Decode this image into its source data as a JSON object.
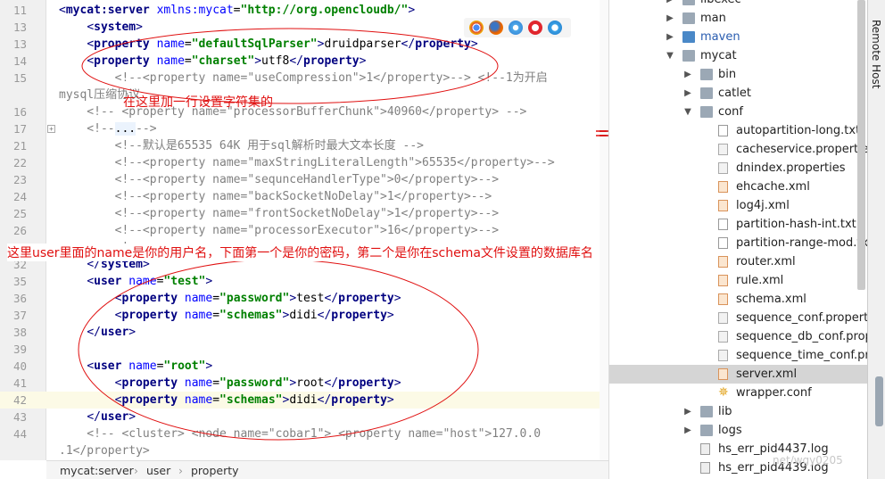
{
  "editor": {
    "lines": [
      {
        "num": "11",
        "parts": [
          [
            "br",
            "<"
          ],
          [
            "tg",
            "mycat:server"
          ],
          [
            "tx",
            " "
          ],
          [
            "at",
            "xmlns:mycat"
          ],
          [
            "tx",
            "="
          ],
          [
            "av",
            "\"http://org.opencloudb/\""
          ],
          [
            "br",
            ">"
          ]
        ]
      },
      {
        "num": "13",
        "parts": [
          [
            "tx",
            "    "
          ],
          [
            "br",
            "<"
          ],
          [
            "tg",
            "system"
          ],
          [
            "br",
            ">"
          ]
        ]
      },
      {
        "num": "13",
        "parts": [
          [
            "tx",
            "    "
          ],
          [
            "br",
            "<"
          ],
          [
            "tg",
            "property"
          ],
          [
            "tx",
            " "
          ],
          [
            "at",
            "name"
          ],
          [
            "tx",
            "="
          ],
          [
            "av",
            "\"defaultSqlParser\""
          ],
          [
            "br",
            ">"
          ],
          [
            "tx",
            "druidparser"
          ],
          [
            "br",
            "</"
          ],
          [
            "tg",
            "property"
          ],
          [
            "br",
            ">"
          ]
        ]
      },
      {
        "num": "14",
        "parts": [
          [
            "tx",
            "    "
          ],
          [
            "br",
            "<"
          ],
          [
            "tg",
            "property"
          ],
          [
            "tx",
            " "
          ],
          [
            "at",
            "name"
          ],
          [
            "tx",
            "="
          ],
          [
            "av",
            "\"charset\""
          ],
          [
            "br",
            ">"
          ],
          [
            "tx",
            "utf8"
          ],
          [
            "br",
            "</"
          ],
          [
            "tg",
            "property"
          ],
          [
            "br",
            ">"
          ]
        ]
      },
      {
        "num": "15",
        "parts": [
          [
            "cm",
            "        <!--<property name=\"useCompression\">1</property>--> <!--1为开启"
          ]
        ]
      },
      {
        "num": "",
        "parts": [
          [
            "cm",
            "mysql压缩协议"
          ]
        ]
      },
      {
        "num": "16",
        "parts": [
          [
            "cm",
            "    <!-- <property name=\"processorBufferChunk\">40960</property> -->"
          ]
        ]
      },
      {
        "num": "17",
        "parts": [
          [
            "cm",
            "    <!--"
          ],
          [
            "hlbox",
            "..."
          ],
          [
            "cm",
            "-->"
          ]
        ]
      },
      {
        "num": "21",
        "parts": [
          [
            "cm",
            "        <!--默认是65535 64K 用于sql解析时最大文本长度 -->"
          ]
        ]
      },
      {
        "num": "22",
        "parts": [
          [
            "cm",
            "        <!--<property name=\"maxStringLiteralLength\">65535</property>-->"
          ]
        ]
      },
      {
        "num": "23",
        "parts": [
          [
            "cm",
            "        <!--<property name=\"sequnceHandlerType\">0</property>-->"
          ]
        ]
      },
      {
        "num": "24",
        "parts": [
          [
            "cm",
            "        <!--<property name=\"backSocketNoDelay\">1</property>-->"
          ]
        ]
      },
      {
        "num": "25",
        "parts": [
          [
            "cm",
            "        <!--<property name=\"frontSocketNoDelay\">1</property>-->"
          ]
        ]
      },
      {
        "num": "26",
        "parts": [
          [
            "cm",
            "        <!--<property name=\"processorExecutor\">16</property>-->"
          ]
        ]
      },
      {
        "num": "27",
        "parts": [
          [
            "cm",
            "        <!--"
          ]
        ]
      },
      {
        "num": "32",
        "parts": [
          [
            "tx",
            "    "
          ],
          [
            "br",
            "</"
          ],
          [
            "tg",
            "system"
          ],
          [
            "br",
            ">"
          ]
        ]
      },
      {
        "num": "35",
        "parts": [
          [
            "tx",
            "    "
          ],
          [
            "br",
            "<"
          ],
          [
            "tg",
            "user"
          ],
          [
            "tx",
            " "
          ],
          [
            "at",
            "name"
          ],
          [
            "tx",
            "="
          ],
          [
            "av",
            "\"test\""
          ],
          [
            "br",
            ">"
          ]
        ]
      },
      {
        "num": "36",
        "parts": [
          [
            "tx",
            "        "
          ],
          [
            "br",
            "<"
          ],
          [
            "tg",
            "property"
          ],
          [
            "tx",
            " "
          ],
          [
            "at",
            "name"
          ],
          [
            "tx",
            "="
          ],
          [
            "av",
            "\"password\""
          ],
          [
            "br",
            ">"
          ],
          [
            "tx",
            "test"
          ],
          [
            "br",
            "</"
          ],
          [
            "tg",
            "property"
          ],
          [
            "br",
            ">"
          ]
        ]
      },
      {
        "num": "37",
        "parts": [
          [
            "tx",
            "        "
          ],
          [
            "br",
            "<"
          ],
          [
            "tg",
            "property"
          ],
          [
            "tx",
            " "
          ],
          [
            "at",
            "name"
          ],
          [
            "tx",
            "="
          ],
          [
            "av",
            "\"schemas\""
          ],
          [
            "br",
            ">"
          ],
          [
            "tx",
            "didi"
          ],
          [
            "br",
            "</"
          ],
          [
            "tg",
            "property"
          ],
          [
            "br",
            ">"
          ]
        ]
      },
      {
        "num": "38",
        "parts": [
          [
            "tx",
            "    "
          ],
          [
            "br",
            "</"
          ],
          [
            "tg",
            "user"
          ],
          [
            "br",
            ">"
          ]
        ]
      },
      {
        "num": "39",
        "parts": [
          [
            "tx",
            ""
          ]
        ]
      },
      {
        "num": "40",
        "parts": [
          [
            "tx",
            "    "
          ],
          [
            "br",
            "<"
          ],
          [
            "tg",
            "user"
          ],
          [
            "tx",
            " "
          ],
          [
            "at",
            "name"
          ],
          [
            "tx",
            "="
          ],
          [
            "av",
            "\"root\""
          ],
          [
            "br",
            ">"
          ]
        ]
      },
      {
        "num": "41",
        "parts": [
          [
            "tx",
            "        "
          ],
          [
            "br",
            "<"
          ],
          [
            "tg",
            "property"
          ],
          [
            "tx",
            " "
          ],
          [
            "at",
            "name"
          ],
          [
            "tx",
            "="
          ],
          [
            "av",
            "\"password\""
          ],
          [
            "br",
            ">"
          ],
          [
            "tx",
            "root"
          ],
          [
            "br",
            "</"
          ],
          [
            "tg",
            "property"
          ],
          [
            "br",
            ">"
          ]
        ]
      },
      {
        "num": "42",
        "parts": [
          [
            "tx",
            "        "
          ],
          [
            "br",
            "<"
          ],
          [
            "tg",
            "property"
          ],
          [
            "tx",
            " "
          ],
          [
            "at",
            "name"
          ],
          [
            "tx",
            "="
          ],
          [
            "av",
            "\"schemas\""
          ],
          [
            "br",
            ">"
          ],
          [
            "tx",
            "didi"
          ],
          [
            "br",
            "</"
          ],
          [
            "tg",
            "property"
          ],
          [
            "br",
            ">"
          ]
        ]
      },
      {
        "num": "43",
        "parts": [
          [
            "tx",
            "    "
          ],
          [
            "br",
            "</"
          ],
          [
            "tg",
            "user"
          ],
          [
            "br",
            ">"
          ]
        ]
      },
      {
        "num": "44",
        "parts": [
          [
            "cm",
            "    <!-- <cluster> <node name=\"cobar1\"> <property name=\"host\">127.0.0"
          ]
        ]
      },
      {
        "num": "",
        "parts": [
          [
            "cm",
            ".1</property>"
          ]
        ]
      }
    ],
    "highlighted_line": "42",
    "fold_marker": "+"
  },
  "breadcrumb": [
    "mycat:server",
    "user",
    "property"
  ],
  "breadcrumb_separator": "›",
  "tree": [
    {
      "label": "libexec",
      "icon": "folder",
      "arrow": "▶"
    },
    {
      "label": "man",
      "icon": "folder",
      "arrow": "▶"
    },
    {
      "label": "maven",
      "icon": "folder-blue",
      "arrow": "▶"
    },
    {
      "label": "mycat",
      "icon": "folder",
      "arrow": "▼"
    },
    {
      "label": "bin",
      "icon": "folder",
      "arrow": "▶"
    },
    {
      "label": "catlet",
      "icon": "folder",
      "arrow": "▶"
    },
    {
      "label": "conf",
      "icon": "folder",
      "arrow": "▼"
    },
    {
      "label": "autopartition-long.txt",
      "icon": "file-text",
      "arrow": ""
    },
    {
      "label": "cacheservice.properties",
      "icon": "file-properties",
      "arrow": ""
    },
    {
      "label": "dnindex.properties",
      "icon": "file-properties",
      "arrow": ""
    },
    {
      "label": "ehcache.xml",
      "icon": "file-xml",
      "arrow": ""
    },
    {
      "label": "log4j.xml",
      "icon": "file-xml",
      "arrow": ""
    },
    {
      "label": "partition-hash-int.txt",
      "icon": "file-text",
      "arrow": ""
    },
    {
      "label": "partition-range-mod.txt",
      "icon": "file-text",
      "arrow": ""
    },
    {
      "label": "router.xml",
      "icon": "file-xml",
      "arrow": ""
    },
    {
      "label": "rule.xml",
      "icon": "file-xml",
      "arrow": ""
    },
    {
      "label": "schema.xml",
      "icon": "file-xml",
      "arrow": ""
    },
    {
      "label": "sequence_conf.properties",
      "icon": "file-properties",
      "arrow": ""
    },
    {
      "label": "sequence_db_conf.properties",
      "icon": "file-properties",
      "arrow": ""
    },
    {
      "label": "sequence_time_conf.properties",
      "icon": "file-properties",
      "arrow": ""
    },
    {
      "label": "server.xml",
      "icon": "file-xml",
      "arrow": ""
    },
    {
      "label": "wrapper.conf",
      "icon": "gear-file",
      "arrow": ""
    },
    {
      "label": "lib",
      "icon": "folder",
      "arrow": "▶"
    },
    {
      "label": "logs",
      "icon": "folder",
      "arrow": "▶"
    },
    {
      "label": "hs_err_pid4437.log",
      "icon": "file-log",
      "arrow": ""
    },
    {
      "label": "hs_err_pid4439.log",
      "icon": "file-log",
      "arrow": ""
    }
  ],
  "selected_tree_item": "server.xml",
  "remote_host_label": "Remote Host",
  "annotations": {
    "charset_note": "在这里加一行设置字符集的",
    "user_note": "这里user里面的name是你的用户名，下面第一个是你的密码，第二个是你在schema文件设置的数据库名"
  },
  "watermark": "net/wgy0205",
  "colors": {
    "annotation": "#e01010",
    "tag": "#000080",
    "attr": "#0000ff",
    "value": "#008000",
    "comment": "#808080",
    "current_line": "#fcfae6",
    "selected_tree": "#d5d5d5"
  },
  "browser_icons": [
    "chrome-icon",
    "firefox-icon",
    "safari-icon",
    "opera-icon",
    "ie-icon"
  ]
}
